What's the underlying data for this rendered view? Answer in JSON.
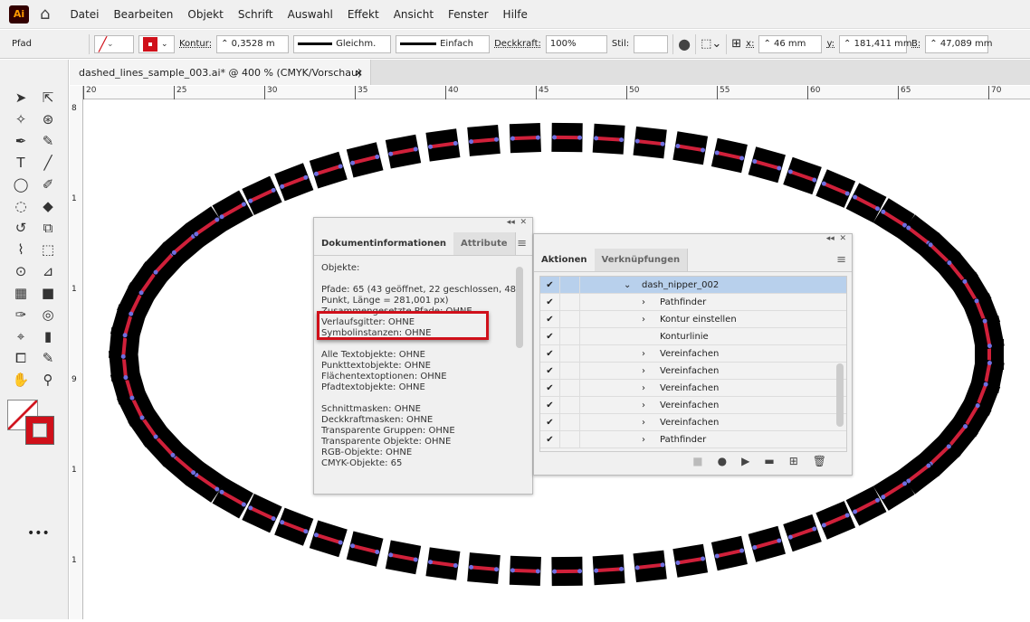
{
  "app": {
    "logo": "Ai"
  },
  "menu": [
    "Datei",
    "Bearbeiten",
    "Objekt",
    "Schrift",
    "Auswahl",
    "Effekt",
    "Ansicht",
    "Fenster",
    "Hilfe"
  ],
  "control": {
    "selection": "Pfad",
    "kontur_label": "Kontur:",
    "kontur_value": "0,3528 m",
    "profile1": "Gleichm.",
    "profile2": "Einfach",
    "opacity_label": "Deckkraft:",
    "opacity": "100%",
    "style_label": "Stil:",
    "x_label": "x:",
    "x": "46 mm",
    "y_label": "y:",
    "y": "181,411 mm",
    "b_label": "B:",
    "b": "47,089 mm",
    "stroke_color": "#d0101a"
  },
  "document": {
    "tab": "dashed_lines_sample_003.ai* @ 400 % (CMYK/Vorschau)",
    "close": "×"
  },
  "ruler": {
    "h": [
      "20",
      "25",
      "30",
      "35",
      "40",
      "45",
      "50",
      "55",
      "60",
      "65",
      "70"
    ],
    "v": [
      "8",
      "1",
      "1",
      "9",
      "1",
      "1"
    ]
  },
  "doc_info": {
    "tabs": [
      "Dokumentinformationen",
      "Attribute"
    ],
    "lines": [
      "Objekte:",
      "",
      "Pfade: 65 (43 geöffnet, 22 geschlossen, 48",
      "Punkt, Länge = 281,001 px)",
      "Zusammengesetzte Pfade: OHNE",
      "Verlaufsgitter: OHNE",
      "Symbolinstanzen: OHNE",
      "",
      "Alle Textobjekte: OHNE",
      "Punkttextobjekte: OHNE",
      "Flächentextoptionen: OHNE",
      "Pfadtextobjekte: OHNE",
      "",
      "Schnittmasken: OHNE",
      "Deckkraftmasken: OHNE",
      "Transparente Gruppen: OHNE",
      "Transparente Objekte: OHNE",
      "RGB-Objekte: OHNE",
      "CMYK-Objekte: 65"
    ]
  },
  "actions": {
    "tabs": [
      "Aktionen",
      "Verknüpfungen"
    ],
    "rows": [
      {
        "label": "dash_nipper_002",
        "level": 0,
        "expander": "⌄",
        "selected": true
      },
      {
        "label": "Pathfinder",
        "level": 1,
        "expander": "›"
      },
      {
        "label": "Kontur einstellen",
        "level": 1,
        "expander": "›"
      },
      {
        "label": "Konturlinie",
        "level": 1,
        "expander": ""
      },
      {
        "label": "Vereinfachen",
        "level": 1,
        "expander": "›"
      },
      {
        "label": "Vereinfachen",
        "level": 1,
        "expander": "›"
      },
      {
        "label": "Vereinfachen",
        "level": 1,
        "expander": "›"
      },
      {
        "label": "Vereinfachen",
        "level": 1,
        "expander": "›"
      },
      {
        "label": "Vereinfachen",
        "level": 1,
        "expander": "›"
      },
      {
        "label": "Pathfinder",
        "level": 1,
        "expander": "›"
      }
    ]
  },
  "artwork": {
    "dash_count": 65,
    "fill": "#000000",
    "stroke": "#d0203a",
    "anchor": "#6f6fe0"
  }
}
